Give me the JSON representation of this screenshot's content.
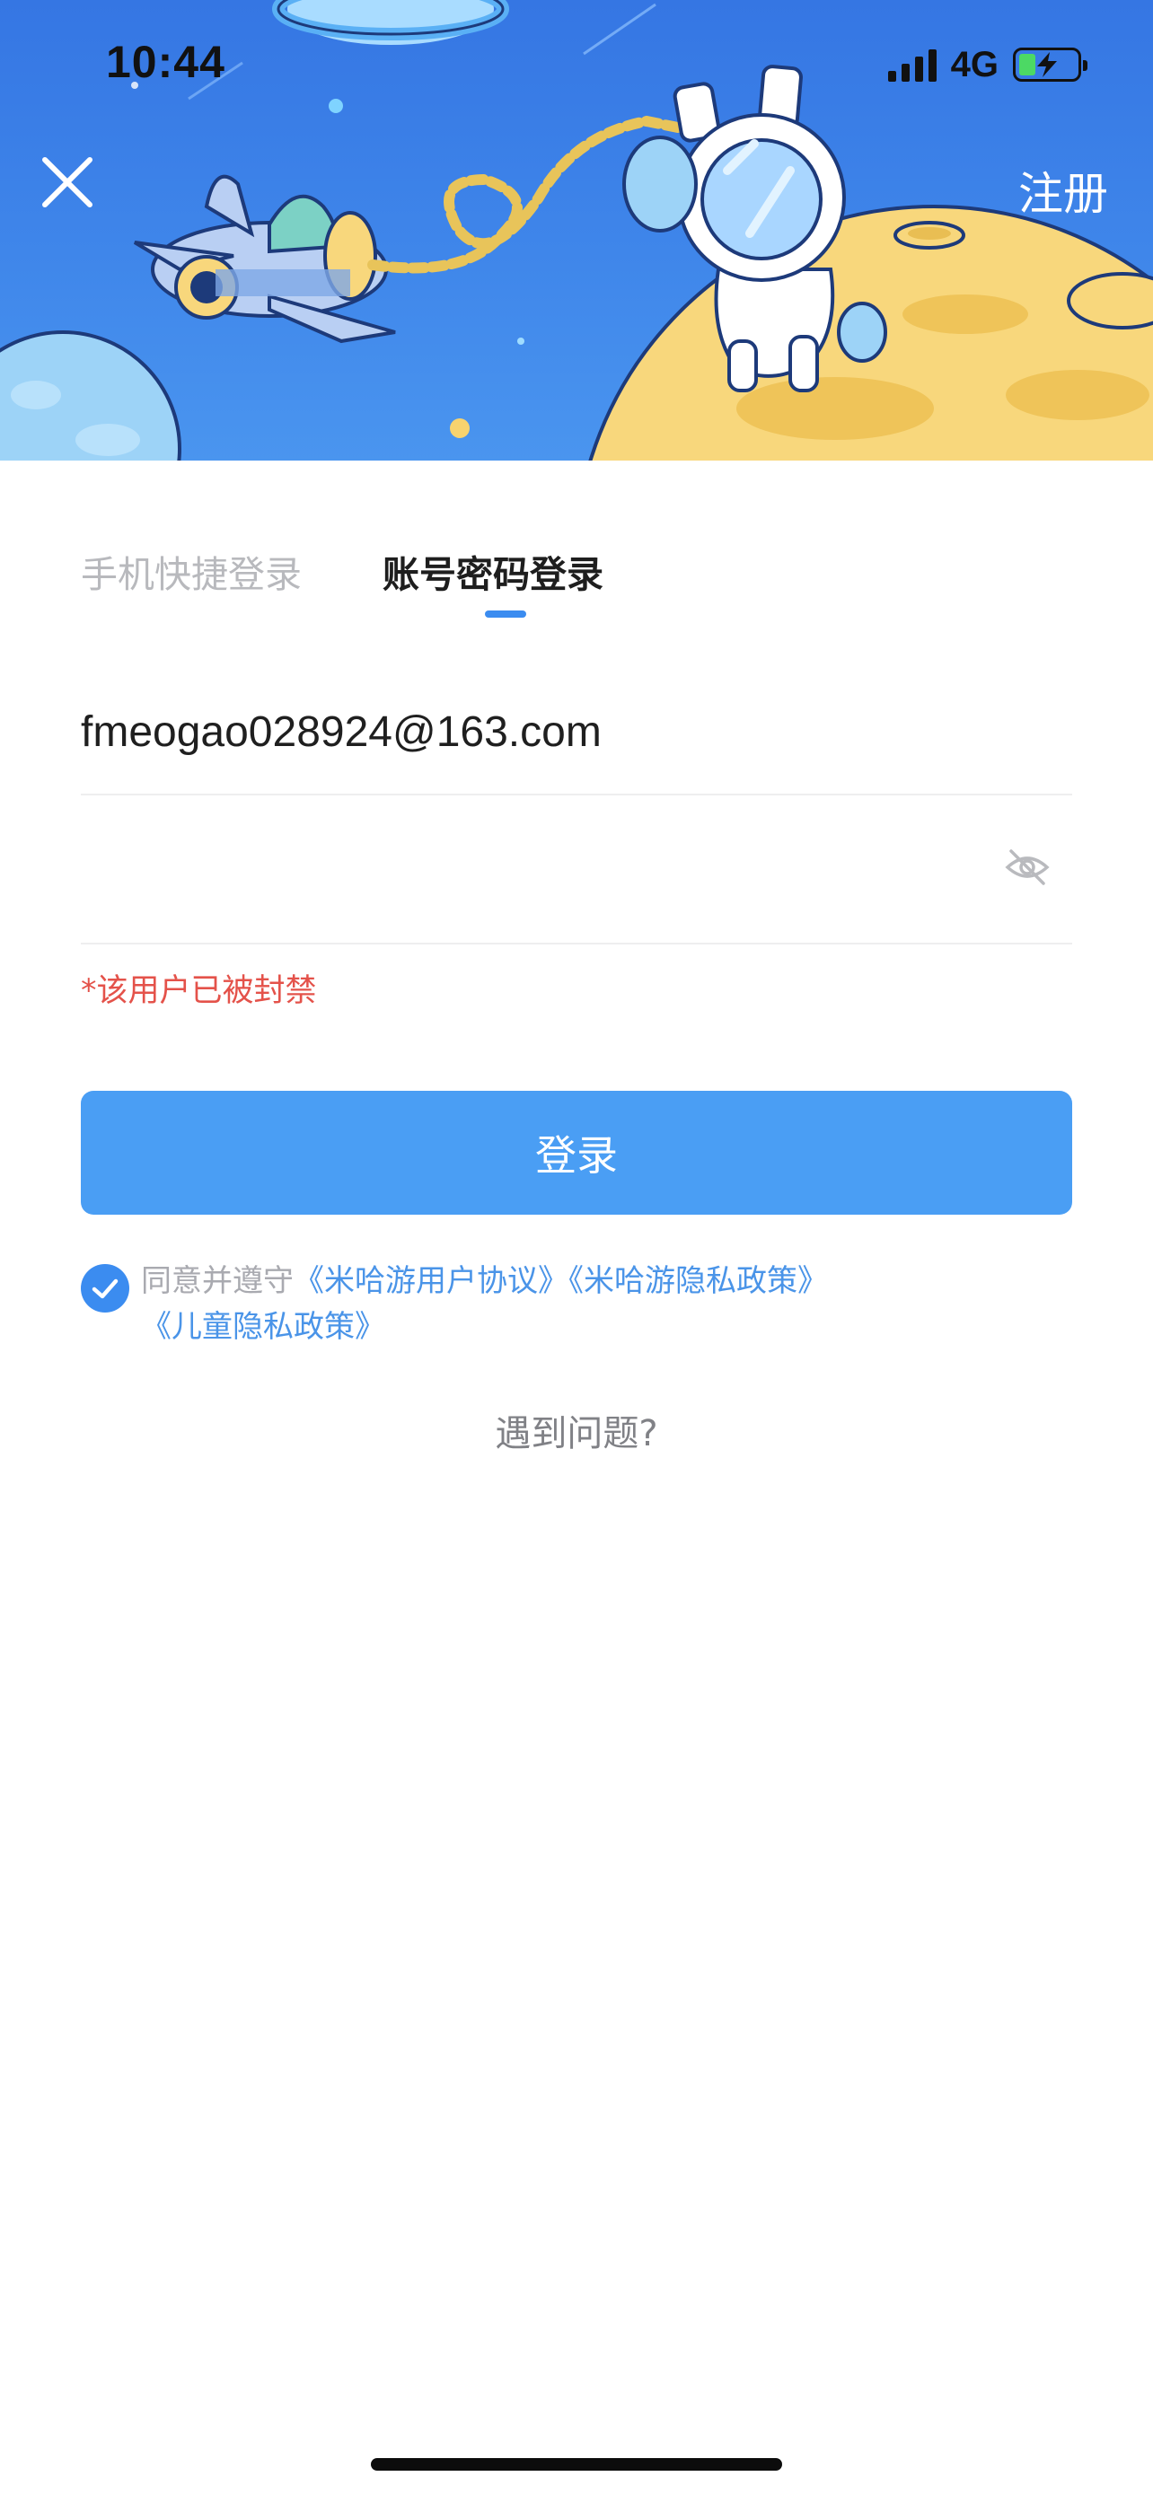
{
  "status_bar": {
    "time": "10:44",
    "network": "4G",
    "icons": [
      "signal-icon",
      "battery-charging-icon"
    ]
  },
  "header": {
    "close_icon": "close-icon",
    "register_label": "注册",
    "illustration": "space-astronaut-illustration"
  },
  "tabs": [
    {
      "label": "手机快捷登录",
      "active": false
    },
    {
      "label": "账号密码登录",
      "active": true
    }
  ],
  "form": {
    "email_value": "fmeogao028924@163.com",
    "password_value": "",
    "password_toggle_icon": "eye-hidden-icon",
    "error_message": "*该用户已被封禁"
  },
  "login_button_label": "登录",
  "agreement": {
    "checked": true,
    "prefix": "同意并遵守",
    "links": [
      "《米哈游用户协议》",
      "《米哈游隐私政策》",
      "《儿童隐私政策》"
    ]
  },
  "help_link": "遇到问题?",
  "colors": {
    "accent": "#3b8cf0",
    "button": "#4a9ef4",
    "error": "#e4524a",
    "link": "#4a94e8",
    "banner": "#3f86ea"
  }
}
